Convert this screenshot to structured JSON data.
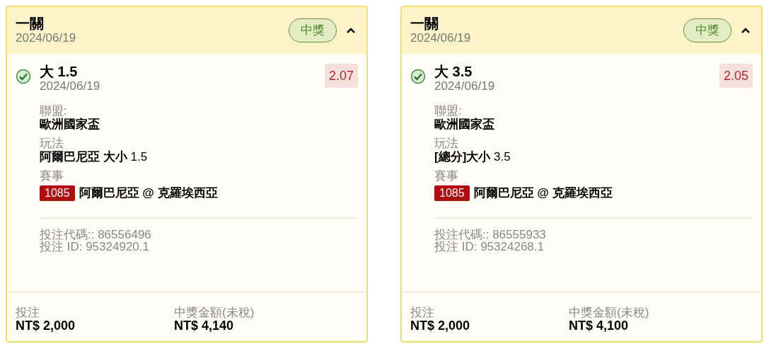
{
  "bets": [
    {
      "title": "一關",
      "date": "2024/06/19",
      "status": "中獎",
      "expanded": true,
      "selection": {
        "won": true,
        "name": "大 1.5",
        "date": "2024/06/19",
        "odds": "2.07"
      },
      "league_label": "聯盟:",
      "league": "歐洲國家盃",
      "market_label": "玩法",
      "market": "**阿爾巴尼亞 大小** 1.5",
      "event_label": "賽事",
      "event_code": "1085",
      "event": "阿爾巴尼亞 @ 克羅埃西亞",
      "bet_code": "投注代碼:: 86556496",
      "bet_id": "投注 ID: 95324920.1",
      "stake_label": "投注",
      "stake": "NT$ 2,000",
      "payout_label": "中獎金額(未稅)",
      "payout": "NT$ 4,140"
    },
    {
      "title": "一關",
      "date": "2024/06/19",
      "status": "中獎",
      "expanded": true,
      "selection": {
        "won": true,
        "name": "大 3.5",
        "date": "2024/06/19",
        "odds": "2.05"
      },
      "league_label": "聯盟:",
      "league": "歐洲國家盃",
      "market_label": "玩法",
      "market": "**[總分]大小** 3.5",
      "event_label": "賽事",
      "event_code": "1085",
      "event": "阿爾巴尼亞 @ 克羅埃西亞",
      "bet_code": "投注代碼:: 86555933",
      "bet_id": "投注 ID: 95324268.1",
      "stake_label": "投注",
      "stake": "NT$ 2,000",
      "payout_label": "中獎金額(未稅)",
      "payout": "NT$ 4,100"
    }
  ]
}
